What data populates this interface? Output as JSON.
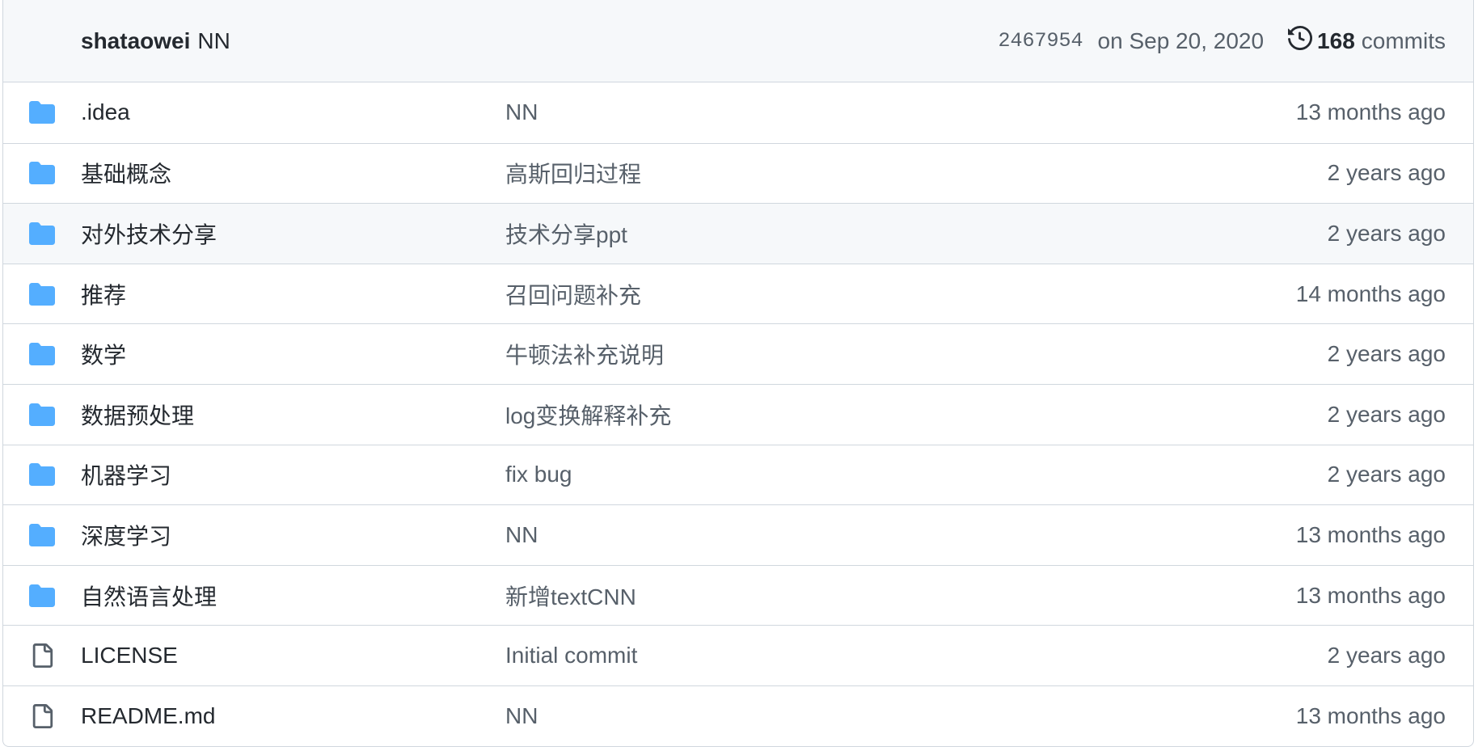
{
  "latest_commit": {
    "author": "shataowei",
    "message": "NN",
    "sha": "2467954",
    "date": "on Sep 20, 2020",
    "commits_count": "168",
    "commits_label": "commits"
  },
  "colors": {
    "folder": "#54aeff",
    "file_icon": "#57606a",
    "border": "#d0d7de",
    "header_bg": "#f6f8fa"
  },
  "files": [
    {
      "type": "folder",
      "icon": "folder-icon",
      "name": ".idea",
      "message": "NN",
      "age": "13 months ago"
    },
    {
      "type": "folder",
      "icon": "folder-icon",
      "name": "基础概念",
      "message": "高斯回归过程",
      "age": "2 years ago"
    },
    {
      "type": "folder",
      "icon": "folder-icon",
      "name": "对外技术分享",
      "message": "技术分享ppt",
      "age": "2 years ago"
    },
    {
      "type": "folder",
      "icon": "folder-icon",
      "name": "推荐",
      "message": "召回问题补充",
      "age": "14 months ago"
    },
    {
      "type": "folder",
      "icon": "folder-icon",
      "name": "数学",
      "message": "牛顿法补充说明",
      "age": "2 years ago"
    },
    {
      "type": "folder",
      "icon": "folder-icon",
      "name": "数据预处理",
      "message": "log变换解释补充",
      "age": "2 years ago"
    },
    {
      "type": "folder",
      "icon": "folder-icon",
      "name": "机器学习",
      "message": "fix bug",
      "age": "2 years ago"
    },
    {
      "type": "folder",
      "icon": "folder-icon",
      "name": "深度学习",
      "message": "NN",
      "age": "13 months ago"
    },
    {
      "type": "folder",
      "icon": "folder-icon",
      "name": "自然语言处理",
      "message": "新增textCNN",
      "age": "13 months ago"
    },
    {
      "type": "file",
      "icon": "file-icon",
      "name": "LICENSE",
      "message": "Initial commit",
      "age": "2 years ago"
    },
    {
      "type": "file",
      "icon": "file-icon",
      "name": "README.md",
      "message": "NN",
      "age": "13 months ago"
    }
  ]
}
